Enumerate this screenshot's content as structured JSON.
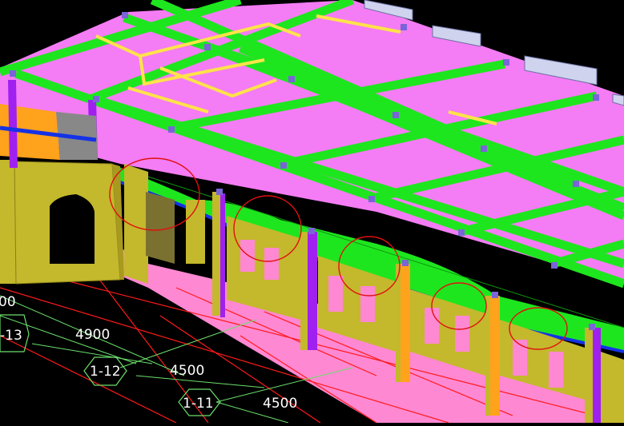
{
  "viewport": {
    "background": "#000000",
    "colors": {
      "slab": "#f47cf4",
      "beam_green": "#1ee61e",
      "beam_yellow": "#ffe34a",
      "wall_olive": "#c4b82c",
      "column_orange": "#ffa21c",
      "column_purple": "#a020f0",
      "edge_blue": "#1432e6",
      "floor_pink": "#ff88d2",
      "grid_red": "#ff1a1a",
      "grid_green": "#6cdf6c",
      "dim_text": "#ffffff",
      "markup_circle": "#e01010",
      "node_violet": "#7a64d8",
      "parapet": "#cfd3ee"
    }
  },
  "grid_labels": [
    {
      "id": "partial",
      "text": "00"
    },
    {
      "id": "axis-1-13",
      "text": "-13"
    },
    {
      "id": "dim-4900",
      "text": "4900"
    },
    {
      "id": "axis-1-12",
      "text": "1-12"
    },
    {
      "id": "dim-4500-a",
      "text": "4500"
    },
    {
      "id": "axis-1-11",
      "text": "1-11"
    },
    {
      "id": "dim-4500-b",
      "text": "4500"
    }
  ]
}
